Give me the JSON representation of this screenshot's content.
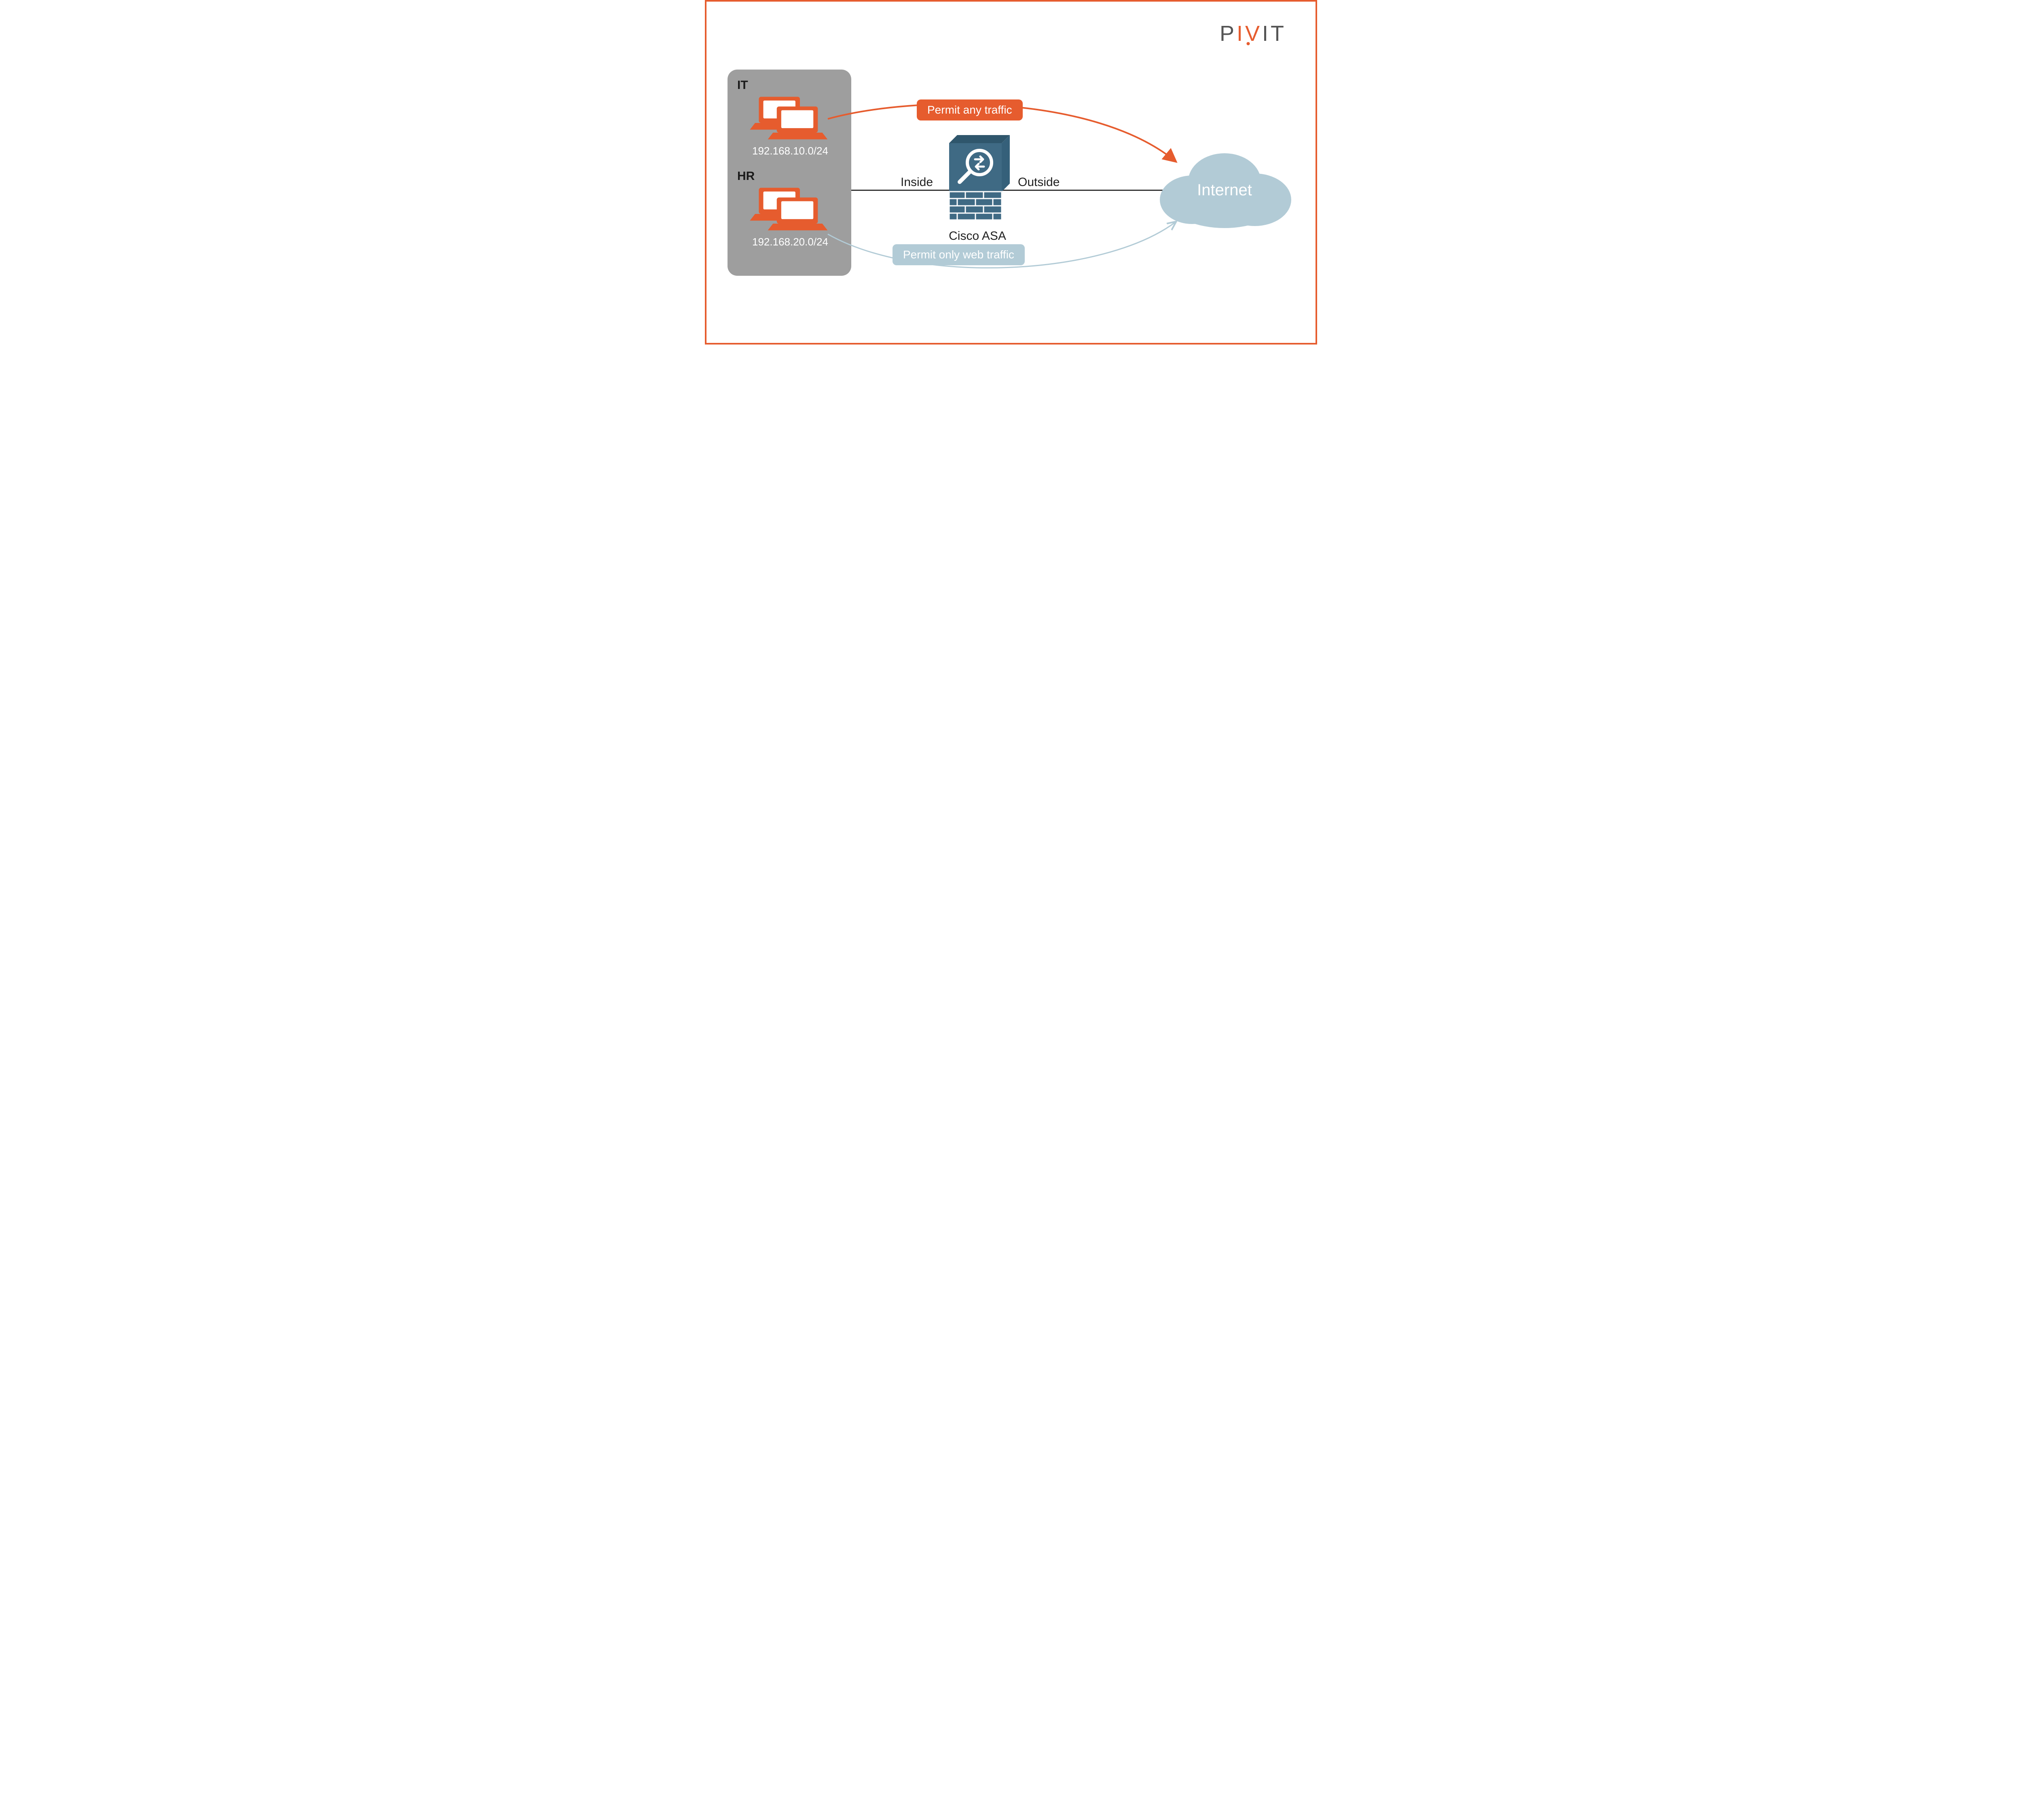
{
  "brand": {
    "p": "P",
    "iv": "IV",
    "it": "IT"
  },
  "groups": {
    "it": {
      "label": "IT",
      "subnet": "192.168.10.0/24"
    },
    "hr": {
      "label": "HR",
      "subnet": "192.168.20.0/24"
    }
  },
  "firewall": {
    "device": "Cisco ASA",
    "if_inside": "Inside",
    "if_outside": "Outside"
  },
  "internet": {
    "label": "Internet"
  },
  "rules": {
    "it_rule": "Permit any traffic",
    "hr_rule": "Permit only web traffic"
  },
  "colors": {
    "accent": "#E65C2E",
    "steel": "#3F6A84",
    "lightsteel": "#B2CBD6"
  }
}
